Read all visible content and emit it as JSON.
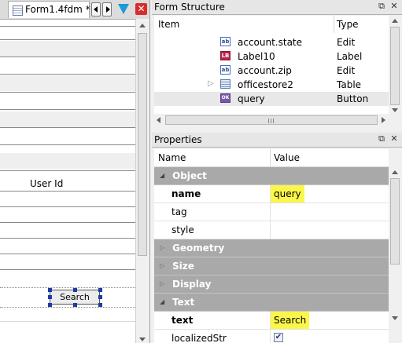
{
  "editor": {
    "tab_title": "Form1.4fdm *",
    "column_label": "User Id",
    "search_button_label": "Search"
  },
  "form_structure": {
    "title": "Form Structure",
    "columns": {
      "item": "Item",
      "type": "Type"
    },
    "rows": [
      {
        "name": "account.state",
        "type": "Edit",
        "icon": "edit-icon",
        "selected": false
      },
      {
        "name": "Label10",
        "type": "Label",
        "icon": "label-icon",
        "selected": false
      },
      {
        "name": "account.zip",
        "type": "Edit",
        "icon": "edit-icon",
        "selected": false
      },
      {
        "name": "officestore2",
        "type": "Table",
        "icon": "table-icon",
        "selected": false
      },
      {
        "name": "query",
        "type": "Button",
        "icon": "button-icon",
        "selected": true
      }
    ]
  },
  "properties": {
    "title": "Properties",
    "columns": {
      "name": "Name",
      "value": "Value"
    },
    "rows": [
      {
        "kind": "group",
        "label": "Object",
        "expanded": true
      },
      {
        "kind": "prop",
        "label": "name",
        "value": "query",
        "bold": true,
        "highlight": true
      },
      {
        "kind": "prop",
        "label": "tag",
        "value": ""
      },
      {
        "kind": "prop",
        "label": "style",
        "value": ""
      },
      {
        "kind": "group",
        "label": "Geometry",
        "expanded": false
      },
      {
        "kind": "group",
        "label": "Size",
        "expanded": false
      },
      {
        "kind": "group",
        "label": "Display",
        "expanded": false
      },
      {
        "kind": "group",
        "label": "Text",
        "expanded": true
      },
      {
        "kind": "prop",
        "label": "text",
        "value": "Search",
        "bold": true,
        "highlight": true
      },
      {
        "kind": "prop",
        "label": "localizedStr",
        "value": "",
        "checkbox": true,
        "checked": true
      }
    ]
  },
  "colors": {
    "highlight": "#fbf64a",
    "group_header": "#a9a9a9",
    "selection_handles": "#1c3aa8",
    "close_button": "#d92b2b",
    "filter_icon": "#1a9ad6"
  }
}
